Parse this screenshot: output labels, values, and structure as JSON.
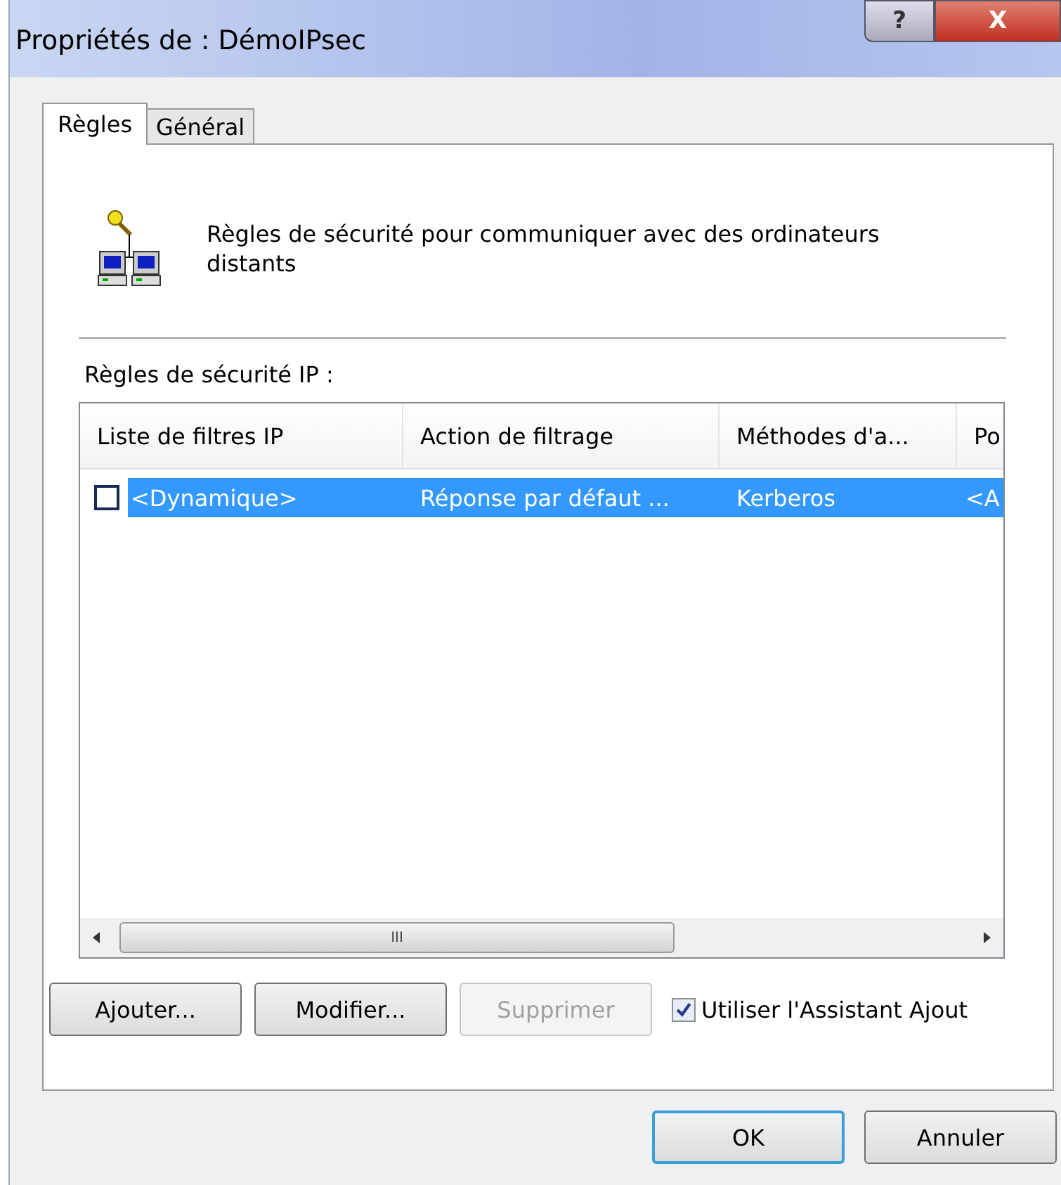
{
  "window": {
    "title": "Propriétés de : DémoIPsec",
    "help_button": "?",
    "close_button": "X"
  },
  "tabs": [
    {
      "label": "Règles",
      "selected": true
    },
    {
      "label": "Général",
      "selected": false
    }
  ],
  "description": "Règles de sécurité pour communiquer avec des ordinateurs distants",
  "list_label": "Règles de sécurité IP :",
  "table": {
    "columns": [
      "Liste de filtres IP",
      "Action de filtrage",
      "Méthodes d'a...",
      "Po"
    ],
    "rows": [
      {
        "checked": false,
        "selected": true,
        "cells": [
          "<Dynamique>",
          "Réponse par défaut ...",
          "Kerberos",
          "<A"
        ]
      }
    ]
  },
  "scrollbar": {
    "grip": "III"
  },
  "buttons": [
    {
      "label": "Ajouter...",
      "disabled": false
    },
    {
      "label": "Modifier...",
      "disabled": false
    },
    {
      "label": "Supprimer",
      "disabled": true
    }
  ],
  "wizard_checkbox": {
    "label": "Utiliser l'Assistant Ajout",
    "checked": true
  },
  "dialog_buttons": [
    {
      "label": "OK",
      "default": true
    },
    {
      "label": "Annuler",
      "default": false
    }
  ]
}
